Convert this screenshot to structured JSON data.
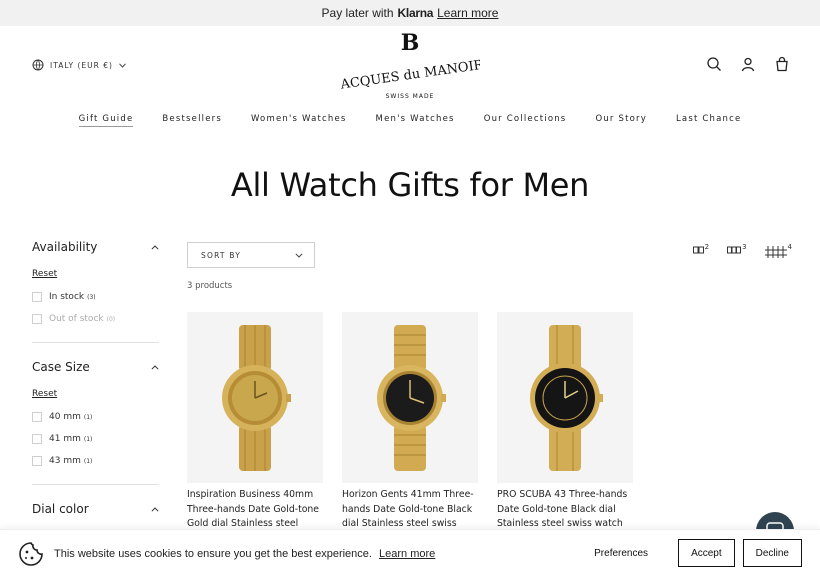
{
  "announcement": {
    "pre": "Pay later with",
    "brand": "Klarna",
    "link": "Learn more"
  },
  "header": {
    "country": "ITALY (EUR €)",
    "logo_line1": "JACQUES du MANOIR",
    "logo_line2": "SWISS MADE"
  },
  "nav": [
    "Gift Guide",
    "Bestsellers",
    "Women's Watches",
    "Men's Watches",
    "Our Collections",
    "Our Story",
    "Last Chance"
  ],
  "page_title": "All Watch Gifts for Men",
  "filters": {
    "availability": {
      "title": "Availability",
      "reset": "Reset",
      "options": [
        {
          "label": "In stock",
          "count": "(3)"
        },
        {
          "label": "Out of stock",
          "count": "(0)"
        }
      ]
    },
    "case_size": {
      "title": "Case Size",
      "reset": "Reset",
      "options": [
        {
          "label": "40 mm",
          "count": "(1)"
        },
        {
          "label": "41 mm",
          "count": "(1)"
        },
        {
          "label": "43 mm",
          "count": "(1)"
        }
      ]
    },
    "dial_color": {
      "title": "Dial color"
    }
  },
  "toolbar": {
    "sort_label": "SORT BY",
    "product_count": "3 products",
    "grid_options": [
      "2",
      "3",
      "4"
    ]
  },
  "products": [
    {
      "name": "Inspiration Business 40mm Three-hands Date Gold-tone Gold dial Stainless steel swiss",
      "dial_color": "#c9a84d"
    },
    {
      "name": "Horizon Gents 41mm Three-hands Date Gold-tone Black dial Stainless steel swiss watch",
      "dial_color": "#1b1b1b"
    },
    {
      "name": "PRO SCUBA 43 Three-hands Date Gold-tone Black dial Stainless steel swiss watch",
      "dial_color": "#151515"
    }
  ],
  "cookie": {
    "text": "This website uses cookies to ensure you get the best experience.",
    "learn_more": "Learn more",
    "preferences": "Preferences",
    "accept": "Accept",
    "decline": "Decline"
  }
}
